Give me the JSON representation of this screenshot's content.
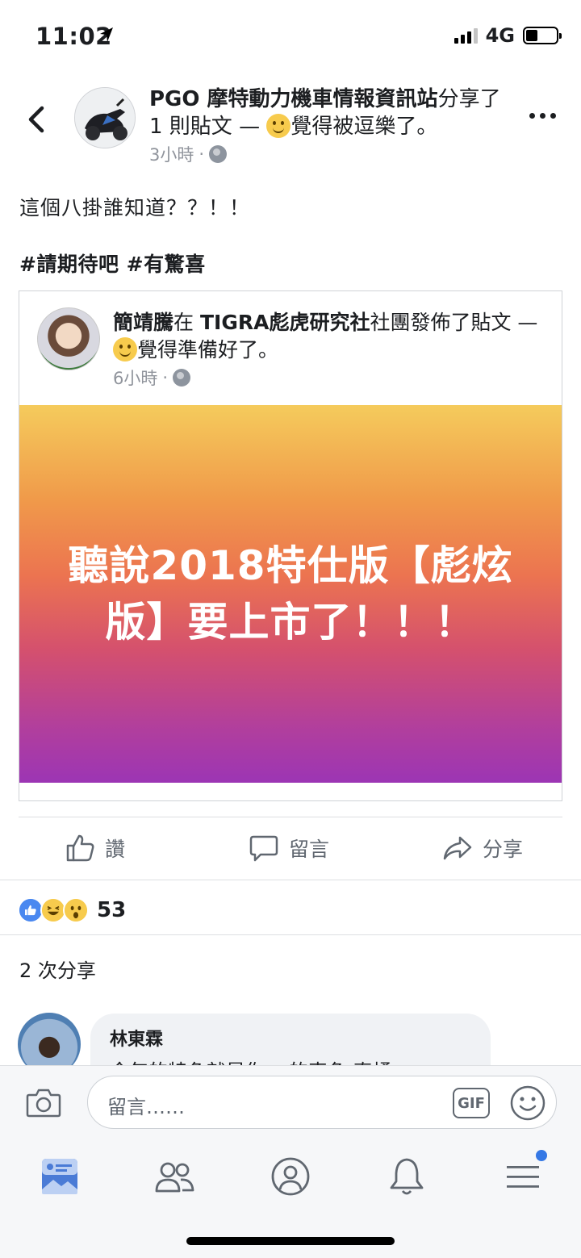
{
  "status_bar": {
    "time": "11:02",
    "network": "4G",
    "signal_bars": 3,
    "battery_level": 0.4
  },
  "post": {
    "author": "PGO 摩特動力機車情報資訊站",
    "header_rest": "分享了 1 則貼文 — ",
    "feeling": "覺得被逗樂了。",
    "time": "3小時",
    "separator": "·",
    "text": "這個八掛誰知道？？！！",
    "hashtags": "#請期待吧 #有驚喜"
  },
  "shared": {
    "author": "簡靖騰",
    "in_word": "在 ",
    "group": "TIGRA彪虎研究社",
    "header_rest": "社團發佈了貼文 — ",
    "feeling": "覺得準備好了。",
    "time": "6小時",
    "separator": "·",
    "banner_text": "聽說2018特仕版【彪炫版】要上市了！！！"
  },
  "actions": {
    "like": "讚",
    "comment": "留言",
    "share": "分享"
  },
  "reactions": {
    "count": "53",
    "types": [
      "like",
      "laugh",
      "wow"
    ]
  },
  "shares": {
    "text": "2 次分享"
  },
  "comment": {
    "name": "林東霖",
    "body": "今年的特色就是你no的車色 真橘"
  },
  "composer": {
    "placeholder": "留言……",
    "gif": "GIF"
  },
  "tabs": [
    "news-feed",
    "friends",
    "profile",
    "notifications",
    "menu"
  ],
  "colors": {
    "accent": "#3578e5",
    "banner_top": "#f5cb5c",
    "banner_bottom": "#9c35b4"
  }
}
